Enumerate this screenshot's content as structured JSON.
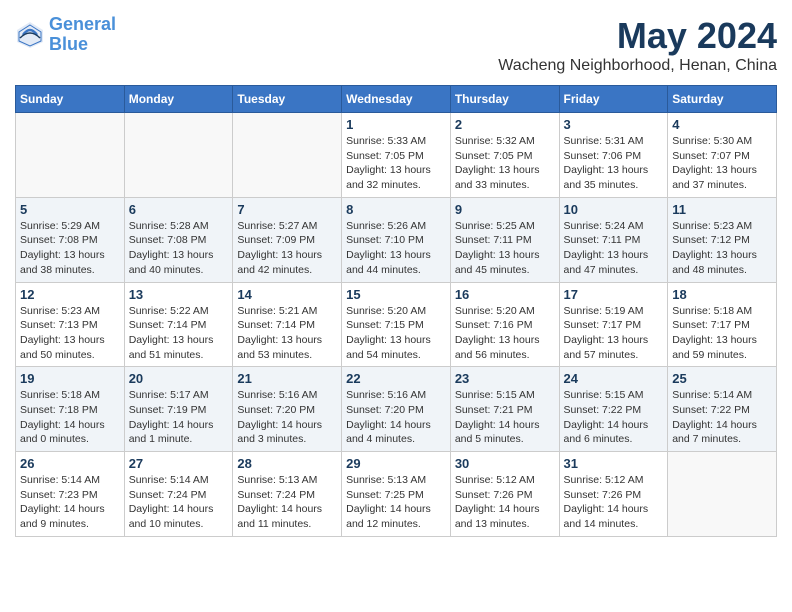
{
  "header": {
    "logo_line1": "General",
    "logo_line2": "Blue",
    "month_year": "May 2024",
    "location": "Wacheng Neighborhood, Henan, China"
  },
  "weekdays": [
    "Sunday",
    "Monday",
    "Tuesday",
    "Wednesday",
    "Thursday",
    "Friday",
    "Saturday"
  ],
  "weeks": [
    [
      {
        "day": "",
        "info": ""
      },
      {
        "day": "",
        "info": ""
      },
      {
        "day": "",
        "info": ""
      },
      {
        "day": "1",
        "info": "Sunrise: 5:33 AM\nSunset: 7:05 PM\nDaylight: 13 hours\nand 32 minutes."
      },
      {
        "day": "2",
        "info": "Sunrise: 5:32 AM\nSunset: 7:05 PM\nDaylight: 13 hours\nand 33 minutes."
      },
      {
        "day": "3",
        "info": "Sunrise: 5:31 AM\nSunset: 7:06 PM\nDaylight: 13 hours\nand 35 minutes."
      },
      {
        "day": "4",
        "info": "Sunrise: 5:30 AM\nSunset: 7:07 PM\nDaylight: 13 hours\nand 37 minutes."
      }
    ],
    [
      {
        "day": "5",
        "info": "Sunrise: 5:29 AM\nSunset: 7:08 PM\nDaylight: 13 hours\nand 38 minutes."
      },
      {
        "day": "6",
        "info": "Sunrise: 5:28 AM\nSunset: 7:08 PM\nDaylight: 13 hours\nand 40 minutes."
      },
      {
        "day": "7",
        "info": "Sunrise: 5:27 AM\nSunset: 7:09 PM\nDaylight: 13 hours\nand 42 minutes."
      },
      {
        "day": "8",
        "info": "Sunrise: 5:26 AM\nSunset: 7:10 PM\nDaylight: 13 hours\nand 44 minutes."
      },
      {
        "day": "9",
        "info": "Sunrise: 5:25 AM\nSunset: 7:11 PM\nDaylight: 13 hours\nand 45 minutes."
      },
      {
        "day": "10",
        "info": "Sunrise: 5:24 AM\nSunset: 7:11 PM\nDaylight: 13 hours\nand 47 minutes."
      },
      {
        "day": "11",
        "info": "Sunrise: 5:23 AM\nSunset: 7:12 PM\nDaylight: 13 hours\nand 48 minutes."
      }
    ],
    [
      {
        "day": "12",
        "info": "Sunrise: 5:23 AM\nSunset: 7:13 PM\nDaylight: 13 hours\nand 50 minutes."
      },
      {
        "day": "13",
        "info": "Sunrise: 5:22 AM\nSunset: 7:14 PM\nDaylight: 13 hours\nand 51 minutes."
      },
      {
        "day": "14",
        "info": "Sunrise: 5:21 AM\nSunset: 7:14 PM\nDaylight: 13 hours\nand 53 minutes."
      },
      {
        "day": "15",
        "info": "Sunrise: 5:20 AM\nSunset: 7:15 PM\nDaylight: 13 hours\nand 54 minutes."
      },
      {
        "day": "16",
        "info": "Sunrise: 5:20 AM\nSunset: 7:16 PM\nDaylight: 13 hours\nand 56 minutes."
      },
      {
        "day": "17",
        "info": "Sunrise: 5:19 AM\nSunset: 7:17 PM\nDaylight: 13 hours\nand 57 minutes."
      },
      {
        "day": "18",
        "info": "Sunrise: 5:18 AM\nSunset: 7:17 PM\nDaylight: 13 hours\nand 59 minutes."
      }
    ],
    [
      {
        "day": "19",
        "info": "Sunrise: 5:18 AM\nSunset: 7:18 PM\nDaylight: 14 hours\nand 0 minutes."
      },
      {
        "day": "20",
        "info": "Sunrise: 5:17 AM\nSunset: 7:19 PM\nDaylight: 14 hours\nand 1 minute."
      },
      {
        "day": "21",
        "info": "Sunrise: 5:16 AM\nSunset: 7:20 PM\nDaylight: 14 hours\nand 3 minutes."
      },
      {
        "day": "22",
        "info": "Sunrise: 5:16 AM\nSunset: 7:20 PM\nDaylight: 14 hours\nand 4 minutes."
      },
      {
        "day": "23",
        "info": "Sunrise: 5:15 AM\nSunset: 7:21 PM\nDaylight: 14 hours\nand 5 minutes."
      },
      {
        "day": "24",
        "info": "Sunrise: 5:15 AM\nSunset: 7:22 PM\nDaylight: 14 hours\nand 6 minutes."
      },
      {
        "day": "25",
        "info": "Sunrise: 5:14 AM\nSunset: 7:22 PM\nDaylight: 14 hours\nand 7 minutes."
      }
    ],
    [
      {
        "day": "26",
        "info": "Sunrise: 5:14 AM\nSunset: 7:23 PM\nDaylight: 14 hours\nand 9 minutes."
      },
      {
        "day": "27",
        "info": "Sunrise: 5:14 AM\nSunset: 7:24 PM\nDaylight: 14 hours\nand 10 minutes."
      },
      {
        "day": "28",
        "info": "Sunrise: 5:13 AM\nSunset: 7:24 PM\nDaylight: 14 hours\nand 11 minutes."
      },
      {
        "day": "29",
        "info": "Sunrise: 5:13 AM\nSunset: 7:25 PM\nDaylight: 14 hours\nand 12 minutes."
      },
      {
        "day": "30",
        "info": "Sunrise: 5:12 AM\nSunset: 7:26 PM\nDaylight: 14 hours\nand 13 minutes."
      },
      {
        "day": "31",
        "info": "Sunrise: 5:12 AM\nSunset: 7:26 PM\nDaylight: 14 hours\nand 14 minutes."
      },
      {
        "day": "",
        "info": ""
      }
    ]
  ]
}
